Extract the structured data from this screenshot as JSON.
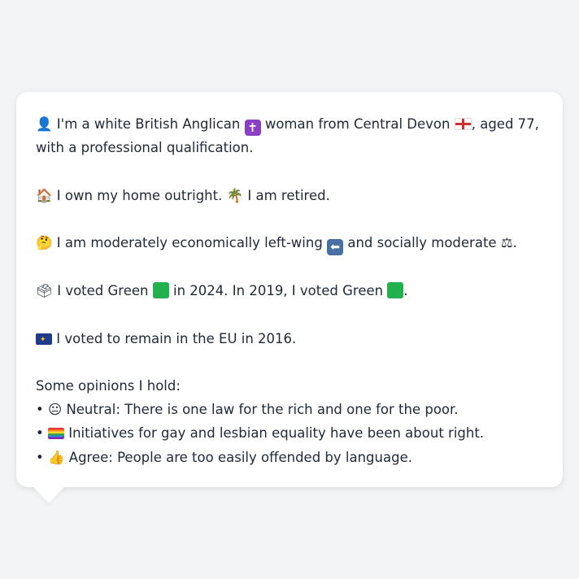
{
  "profile": {
    "line1_a": "I'm a white British Anglican",
    "line1_b": "woman from Central Devon",
    "line1_c": ", aged 77,",
    "line1_d": "with a professional qualification.",
    "home_a": "I own my home outright.",
    "home_b": "I am retired.",
    "politics_a": "I am moderately economically left-wing",
    "politics_b": "and socially moderate",
    "politics_c": ".",
    "vote_a": "I voted Green",
    "vote_b": "in 2024. In 2019, I voted Green",
    "vote_c": ".",
    "eu": "I voted to remain in the EU in 2016."
  },
  "opinions": {
    "heading": "Some opinions I hold:",
    "items": [
      {
        "bullet": "•",
        "text": "Neutral: There is one law for the rich and one for the poor."
      },
      {
        "bullet": "•",
        "text": "Initiatives for gay and lesbian equality have been about right."
      },
      {
        "bullet": "•",
        "text": "Agree: People are too easily offended by language."
      }
    ]
  },
  "icons": {
    "person": "👤",
    "cross": "✝",
    "house": "🏠",
    "palm": "🌴",
    "thinking": "🤔",
    "left_arrow": "⬅",
    "scales": "⚖",
    "ballot": "🗳",
    "neutral_face": "😐",
    "thumbs_up": "👍"
  },
  "colors": {
    "background": "#f3f4f6",
    "card": "#ffffff",
    "text": "#1f2937",
    "green": "#22b14c"
  }
}
